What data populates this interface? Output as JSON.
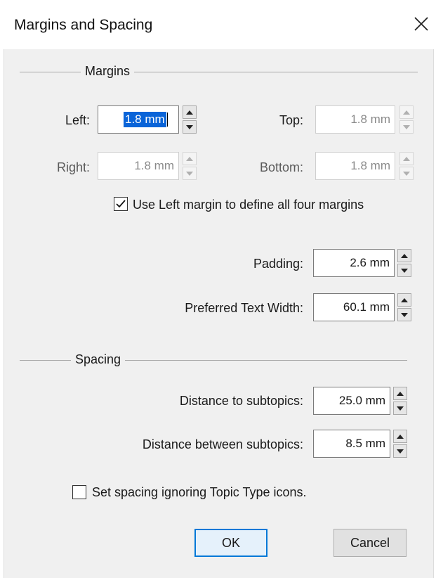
{
  "window": {
    "title": "Margins and Spacing",
    "close_icon": "close-icon"
  },
  "margins": {
    "group_title": "Margins",
    "left": {
      "label": "Left:",
      "value": "1.8 mm",
      "enabled": true
    },
    "top": {
      "label": "Top:",
      "value": "1.8 mm",
      "enabled": false
    },
    "right": {
      "label": "Right:",
      "value": "1.8 mm",
      "enabled": false
    },
    "bottom": {
      "label": "Bottom:",
      "value": "1.8 mm",
      "enabled": false
    },
    "use_left_checkbox": {
      "label": "Use Left margin to define all four margins",
      "checked": true
    }
  },
  "padding": {
    "label": "Padding:",
    "value": "2.6 mm"
  },
  "preferred_text_width": {
    "label": "Preferred Text Width:",
    "value": "60.1 mm"
  },
  "spacing": {
    "group_title": "Spacing",
    "distance_to_subtopics": {
      "label": "Distance to subtopics:",
      "value": "25.0 mm"
    },
    "distance_between_subtopics": {
      "label": "Distance between subtopics:",
      "value": "8.5 mm"
    },
    "ignore_icons_checkbox": {
      "label": "Set spacing ignoring Topic Type icons.",
      "checked": false
    }
  },
  "buttons": {
    "ok": "OK",
    "cancel": "Cancel"
  },
  "colors": {
    "accent": "#0078d7",
    "selection": "#0a64d8",
    "dialog_bg": "#f0f0f0"
  }
}
